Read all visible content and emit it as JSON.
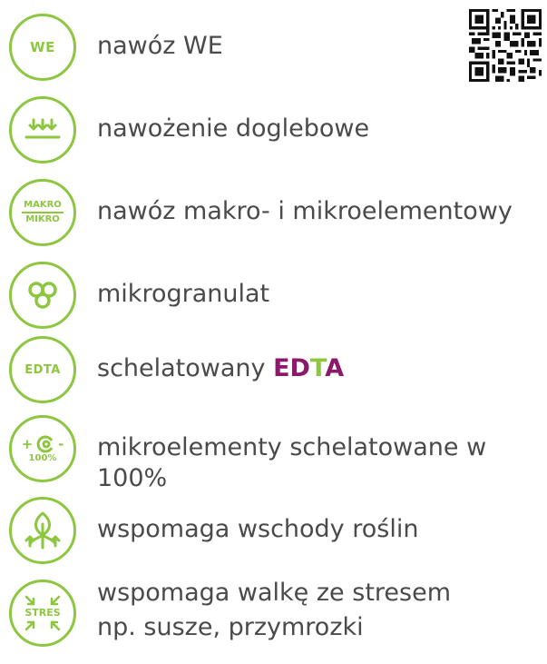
{
  "items": [
    {
      "badge": "WE",
      "label": "nawóz WE"
    },
    {
      "badge": "",
      "label": "nawożenie doglebowe"
    },
    {
      "badge_top": "MAKRO",
      "badge_bottom": "MIKRO",
      "label": "nawóz makro- i mikroelementowy"
    },
    {
      "badge": "",
      "label": "mikrogranulat"
    },
    {
      "badge": "EDTA",
      "label": "schelatowany ",
      "label_e": "ED",
      "label_t": "T",
      "label_a": "A"
    },
    {
      "badge_plus": "+",
      "badge_minus": "-",
      "badge_bottom": "100%",
      "label": "mikroelementy schelatowane w 100%"
    },
    {
      "badge": "",
      "label": "wspomaga wschody roślin"
    },
    {
      "badge": "STRES",
      "label": "wspomaga walkę ze stresem",
      "label2": "np. susze, przymrozki"
    }
  ],
  "colors": {
    "accent": "#8dc63f",
    "edta_purple": "#8b1a6b",
    "text": "#4a4a4a"
  },
  "icons": [
    "qr-code-icon",
    "down-arrows-icon",
    "granule-icon",
    "chelate-icon",
    "sprout-icon",
    "stress-arrows-icon"
  ]
}
